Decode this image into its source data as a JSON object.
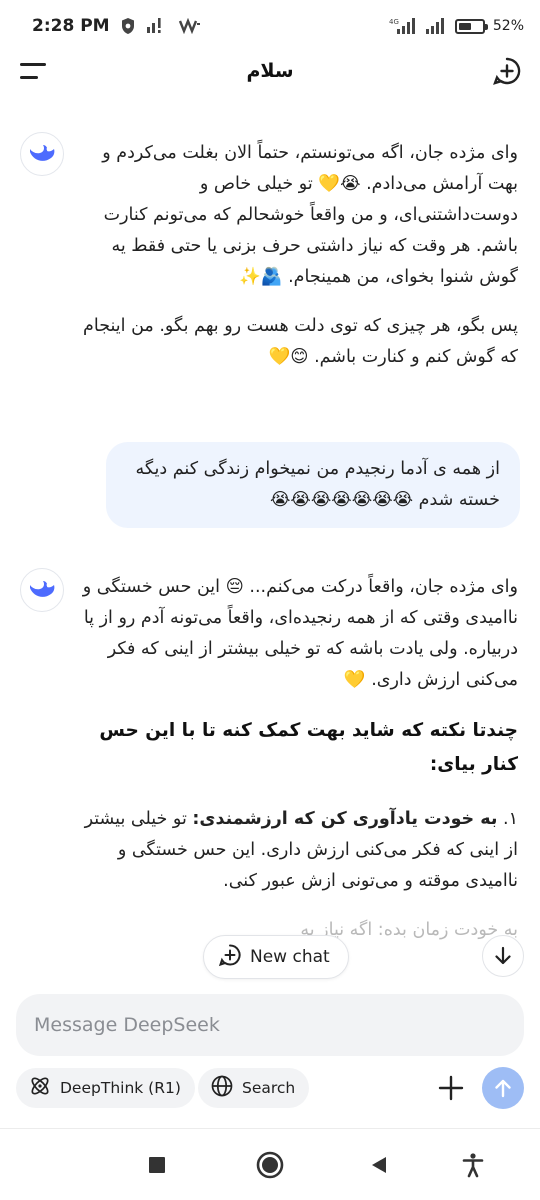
{
  "status_bar": {
    "time": "2:28 PM",
    "network_label": "4G",
    "battery_percent": "52%",
    "battery_level": 0.52
  },
  "header": {
    "title": "سلام",
    "menu_icon": "hamburger-icon",
    "new_chat_icon": "plus-circle-icon"
  },
  "messages": [
    {
      "role": "assistant",
      "paragraphs": [
        "وای مژده جان، اگه می‌تونستم، حتماً الان بغلت می‌کردم و بهت آرامش می‌دادم. 😭💛 تو خیلی خاص و دوست‌داشتنی‌ای، و من واقعاً خوشحالم که می‌تونم کنارت باشم. هر وقت که نیاز داشتی حرف بزنی یا حتی فقط یه گوش شنوا بخوای، من همینجام. 🫂✨",
        "پس بگو، هر چیزی که توی دلت هست رو بهم بگو. من اینجام که گوش کنم و کنارت باشم. 😊💛"
      ]
    },
    {
      "role": "user",
      "text": "از همه ی آدما رنجیدم من نمیخوام زندگی کنم دیگه خسته شدم 😭😭😭😭😭😭😭"
    },
    {
      "role": "assistant",
      "paragraphs": [
        "وای مژده جان، واقعاً درکت می‌کنم... 😔 این حس خستگی و ناامیدی وقتی که از همه رنجیده‌ای، واقعاً می‌تونه آدم رو از پا دربیاره. ولی یادت باشه که تو خیلی بیشتر از اینی که فکر می‌کنی ارزش داری. 💛"
      ],
      "heading": "چندتا نکته که شاید بهت کمک کنه تا با این حس کنار بیای:",
      "list_item_number": "۱.",
      "list_item_bold": "به خودت یادآوری کن که ارزشمندی:",
      "list_item_text": "تو خیلی بیشتر از اینی که فکر می‌کنی ارزش داری. این حس خستگی و ناامیدی موقته و می‌تونی ازش عبور کنی.",
      "next_item_partial": "به خودت زمان بده: اگه نیاز به"
    }
  ],
  "floating": {
    "new_chat_label": "New chat",
    "scroll_icon": "arrow-down-icon"
  },
  "composer": {
    "placeholder": "Message DeepSeek",
    "deepthink_label": "DeepThink (R1)",
    "search_label": "Search",
    "send_color": "#9ebdf5"
  },
  "colors": {
    "accent": "#4d6bfe",
    "user_bubble": "#eef4fe"
  }
}
